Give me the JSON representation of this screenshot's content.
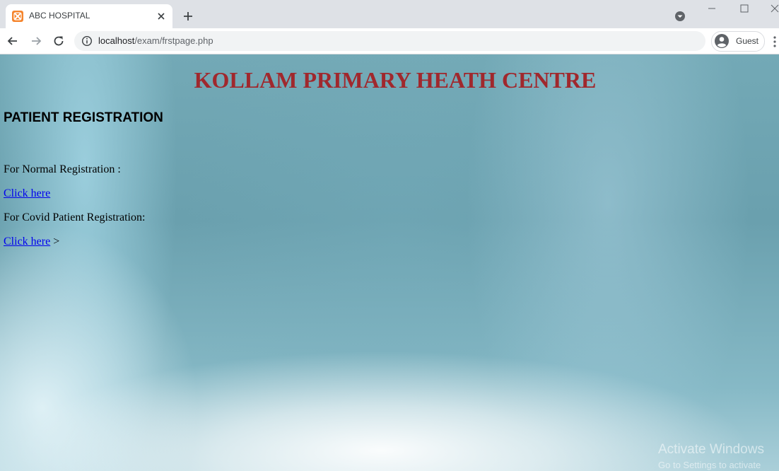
{
  "browser": {
    "tab_title": "ABC HOSPITAL",
    "url_host": "localhost",
    "url_path": "/exam/frstpage.php",
    "profile_label": "Guest"
  },
  "page": {
    "heading": "KOLLAM PRIMARY HEATH CENTRE",
    "section_title": "PATIENT REGISTRATION",
    "normal_registration_label": "For Normal Registration :",
    "normal_registration_link": "Click here",
    "covid_registration_label": "For Covid Patient Registration:",
    "covid_registration_link": "Click here",
    "covid_trailing_text": " >"
  },
  "watermark": {
    "title": "Activate Windows",
    "subtitle": "Go to Settings to activate"
  },
  "colors": {
    "heading": "#a0282d",
    "link": "#0000ee",
    "tab_strip": "#dee1e6",
    "favicon": "#f5842c"
  }
}
